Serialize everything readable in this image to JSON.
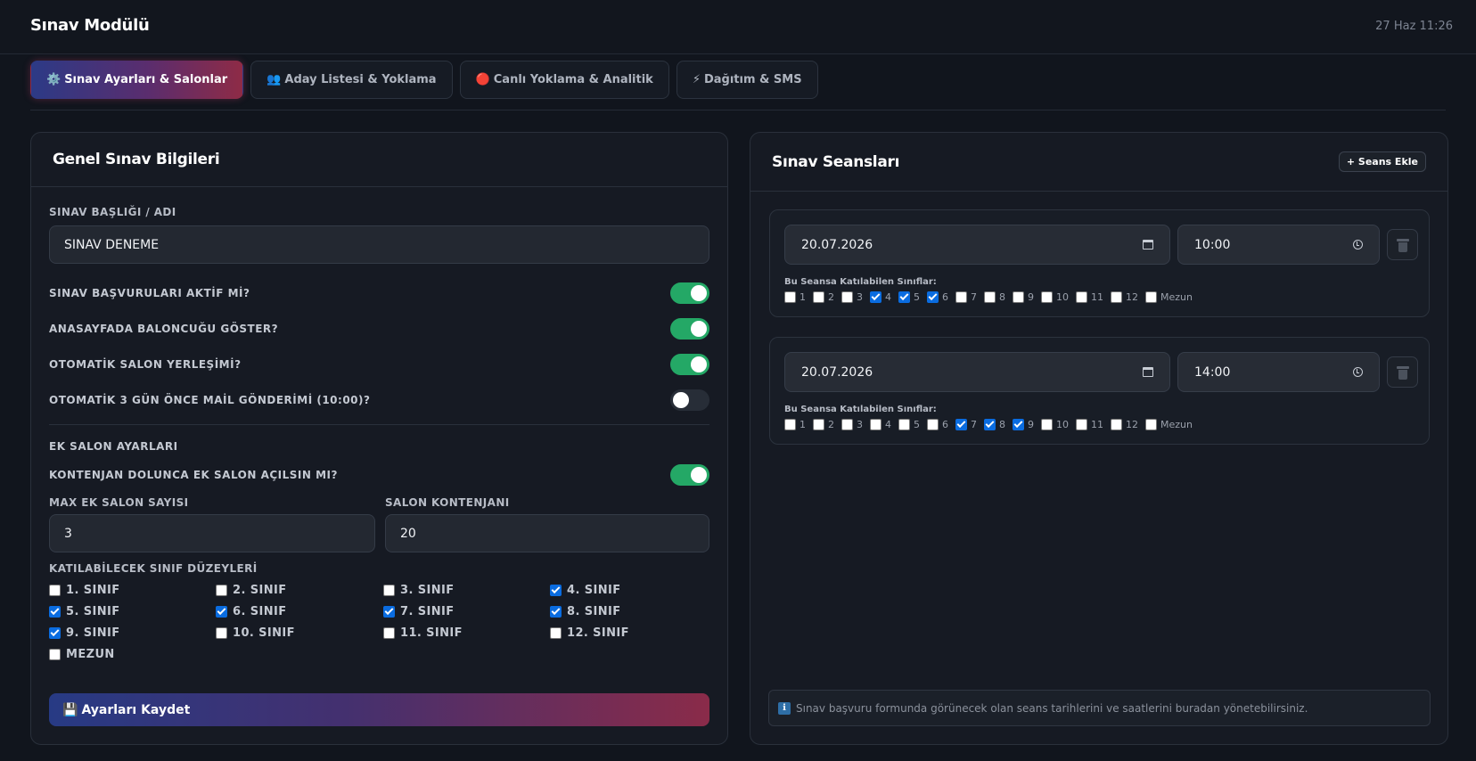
{
  "header": {
    "title": "Sınav Modülü",
    "datetime": "27 Haz 11:26"
  },
  "tabs": [
    {
      "icon": "⚙️",
      "icon_name": "gear-icon",
      "label": "Sınav Ayarları & Salonlar",
      "active": true
    },
    {
      "icon": "👥",
      "icon_name": "users-icon",
      "label": "Aday Listesi & Yoklama",
      "active": false
    },
    {
      "icon": "🔴",
      "icon_name": "red-circle-icon",
      "label": "Canlı Yoklama & Analitik",
      "active": false
    },
    {
      "icon": "⚡",
      "icon_name": "lightning-icon",
      "label": "Dağıtım & SMS",
      "active": false
    }
  ],
  "general": {
    "title": "Genel Sınav Bilgileri",
    "exam_title_label": "SINAV BAŞLIĞI / ADI",
    "exam_title_value": "SINAV DENEME",
    "toggles": [
      {
        "label": "SINAV BAŞVURULARI AKTİF Mİ?",
        "on": true
      },
      {
        "label": "ANASAYFADA BALONCUĞU GÖSTER?",
        "on": true
      },
      {
        "label": "OTOMATİK SALON YERLEŞİMİ?",
        "on": true
      },
      {
        "label": "OTOMATİK 3 GÜN ÖNCE MAİL GÖNDERİMİ (10:00)?",
        "on": false
      }
    ],
    "extra_section_title": "EK SALON AYARLARI",
    "extra_toggle": {
      "label": "KONTENJAN DOLUNCA EK SALON AÇILSIN MI?",
      "on": true
    },
    "max_extra_label": "MAX EK SALON SAYISI",
    "max_extra_value": "3",
    "capacity_label": "SALON KONTENJANI",
    "capacity_value": "20",
    "grades_label": "KATILABİLECEK SINIF DÜZEYLERİ",
    "grades": [
      {
        "label": "1. SINIF",
        "checked": false
      },
      {
        "label": "2. SINIF",
        "checked": false
      },
      {
        "label": "3. SINIF",
        "checked": false
      },
      {
        "label": "4. SINIF",
        "checked": true
      },
      {
        "label": "5. SINIF",
        "checked": true
      },
      {
        "label": "6. SINIF",
        "checked": true
      },
      {
        "label": "7. SINIF",
        "checked": true
      },
      {
        "label": "8. SINIF",
        "checked": true
      },
      {
        "label": "9. SINIF",
        "checked": true
      },
      {
        "label": "10. SINIF",
        "checked": false
      },
      {
        "label": "11. SINIF",
        "checked": false
      },
      {
        "label": "12. SINIF",
        "checked": false
      },
      {
        "label": "MEZUN",
        "checked": false
      }
    ],
    "save_icon": "💾",
    "save_label": "Ayarları Kaydet"
  },
  "sessions": {
    "title": "Sınav Seansları",
    "add_label": "+ Seans Ekle",
    "grades_caption": "Bu Seansa Katılabilen Sınıflar:",
    "items": [
      {
        "date": "20.07.2026",
        "time": "10:00",
        "grades": [
          {
            "label": "1",
            "checked": false
          },
          {
            "label": "2",
            "checked": false
          },
          {
            "label": "3",
            "checked": false
          },
          {
            "label": "4",
            "checked": true
          },
          {
            "label": "5",
            "checked": true
          },
          {
            "label": "6",
            "checked": true
          },
          {
            "label": "7",
            "checked": false
          },
          {
            "label": "8",
            "checked": false
          },
          {
            "label": "9",
            "checked": false
          },
          {
            "label": "10",
            "checked": false
          },
          {
            "label": "11",
            "checked": false
          },
          {
            "label": "12",
            "checked": false
          },
          {
            "label": "Mezun",
            "checked": false
          }
        ]
      },
      {
        "date": "20.07.2026",
        "time": "14:00",
        "grades": [
          {
            "label": "1",
            "checked": false
          },
          {
            "label": "2",
            "checked": false
          },
          {
            "label": "3",
            "checked": false
          },
          {
            "label": "4",
            "checked": false
          },
          {
            "label": "5",
            "checked": false
          },
          {
            "label": "6",
            "checked": false
          },
          {
            "label": "7",
            "checked": true
          },
          {
            "label": "8",
            "checked": true
          },
          {
            "label": "9",
            "checked": true
          },
          {
            "label": "10",
            "checked": false
          },
          {
            "label": "11",
            "checked": false
          },
          {
            "label": "12",
            "checked": false
          },
          {
            "label": "Mezun",
            "checked": false
          }
        ]
      }
    ],
    "info_icon": "ℹ",
    "info_text": "Sınav başvuru formunda görünecek olan seans tarihlerini ve saatlerini buradan yönetebilirsiniz."
  }
}
